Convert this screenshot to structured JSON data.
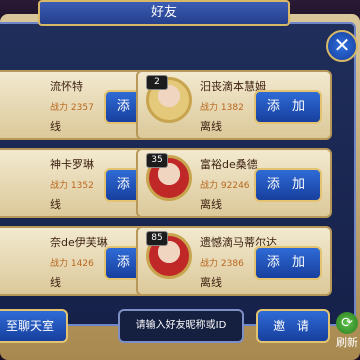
{
  "header": {
    "title": "好友"
  },
  "friends": [
    {
      "name": "流怀特",
      "power_label": "战力",
      "power": "2357",
      "status": "线",
      "add_label": "添 加"
    },
    {
      "name": "汨丧滴本慧姆",
      "level": "2",
      "power_label": "战力",
      "power": "1382",
      "status": "离线",
      "add_label": "添 加"
    },
    {
      "name": "神卡罗琳",
      "power_label": "战力",
      "power": "1352",
      "status": "线",
      "add_label": "添 加"
    },
    {
      "name": "富裕de桑德",
      "level": "35",
      "power_label": "战力",
      "power": "92246",
      "status": "离线",
      "add_label": "添 加"
    },
    {
      "name": "奈de伊芙琳",
      "power_label": "战力",
      "power": "1426",
      "status": "线",
      "add_label": "添 加"
    },
    {
      "name": "遗憾滴马蒂尔达",
      "level": "85",
      "power_label": "战力",
      "power": "2386",
      "status": "离线",
      "add_label": "添 加"
    }
  ],
  "bottom": {
    "chat_label": "至聊天室",
    "search_placeholder": "请输入好友昵称或ID",
    "invite_label": "邀 请",
    "refresh_label": "刷新"
  },
  "icons": {
    "close": "close-icon",
    "refresh": "refresh-icon"
  }
}
